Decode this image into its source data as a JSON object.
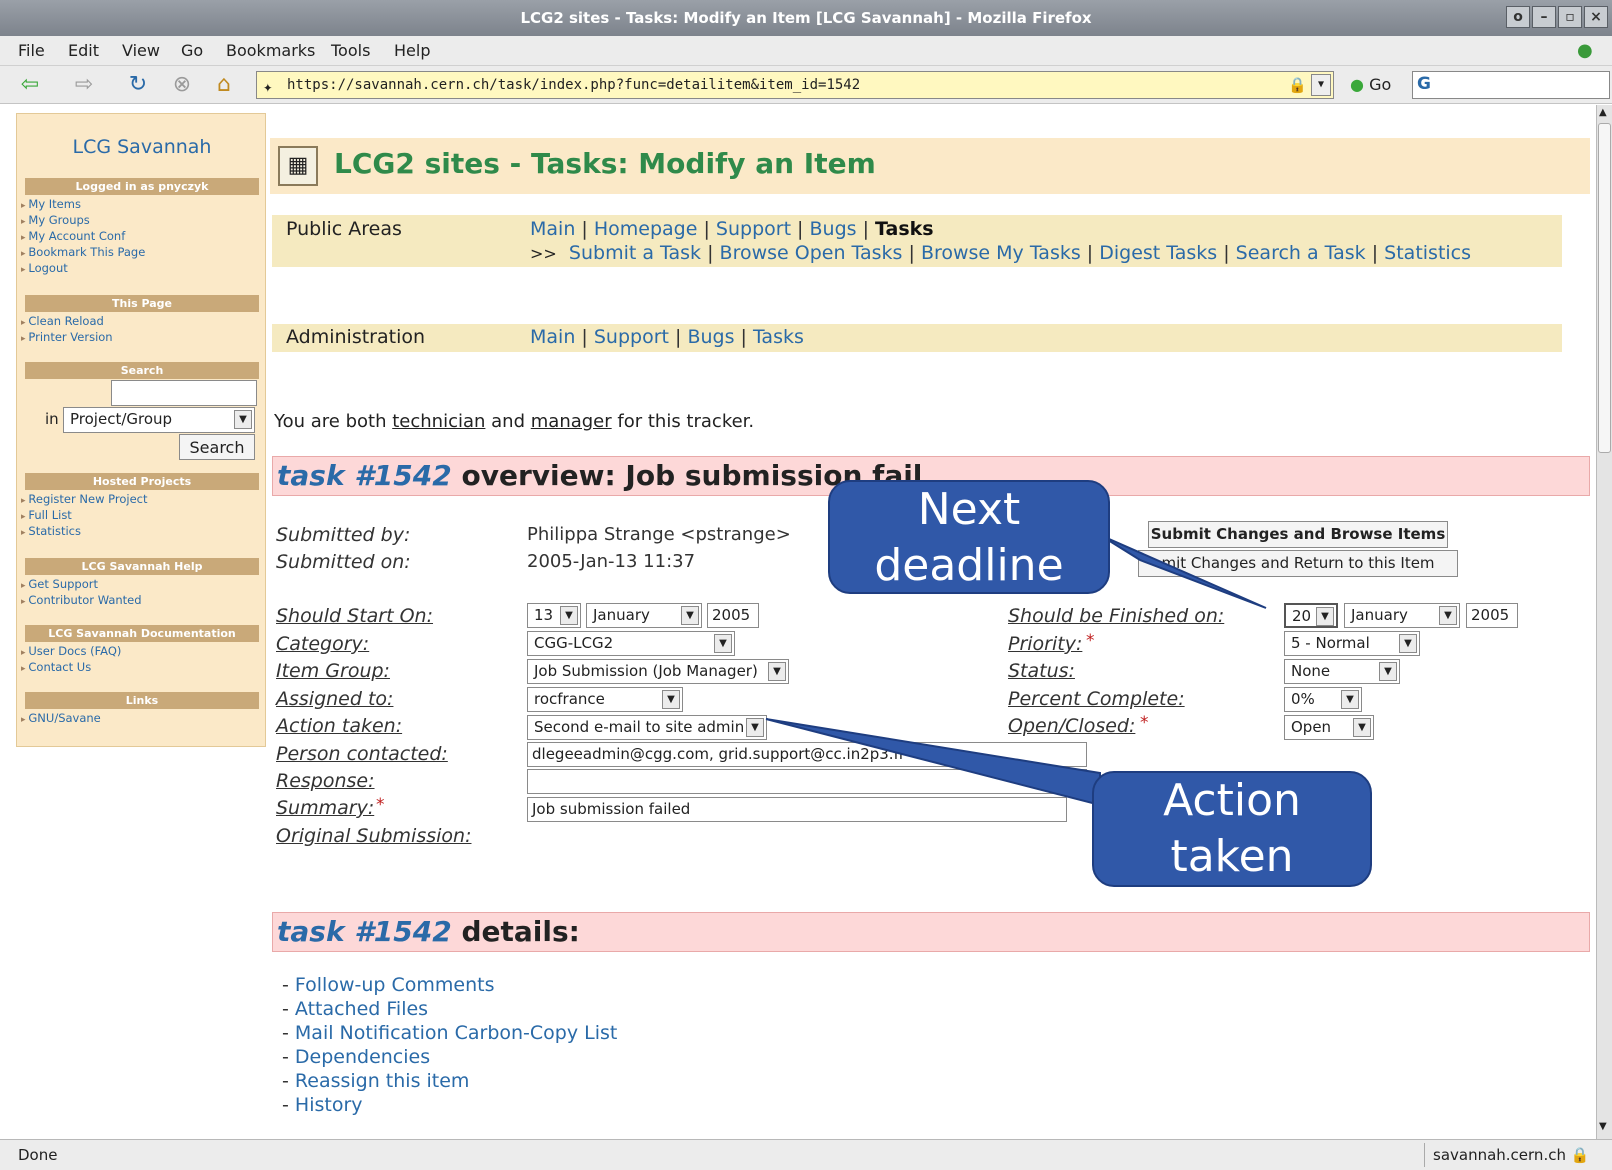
{
  "window": {
    "title": "LCG2 sites - Tasks: Modify an Item [LCG Savannah] - Mozilla Firefox"
  },
  "menu": [
    "File",
    "Edit",
    "View",
    "Go",
    "Bookmarks",
    "Tools",
    "Help"
  ],
  "nav": {
    "url": "https://savannah.cern.ch/task/index.php?func=detailitem&item_id=1542",
    "go_label": "Go"
  },
  "sidebar": {
    "title": "LCG Savannah",
    "logged_in": "Logged in as pnyczyk",
    "user_links": [
      "My Items",
      "My Groups",
      "My Account Conf",
      "Bookmark This Page",
      "Logout"
    ],
    "this_page_head": "This Page",
    "this_page_links": [
      "Clean Reload",
      "Printer Version"
    ],
    "search_head": "Search",
    "search_in_label": "in",
    "search_scope": "Project/Group",
    "search_button": "Search",
    "hosted_head": "Hosted Projects",
    "hosted_links": [
      "Register New Project",
      "Full List",
      "Statistics"
    ],
    "help_head": "LCG Savannah Help",
    "help_links": [
      "Get Support",
      "Contributor Wanted"
    ],
    "docs_head": "LCG Savannah Documentation",
    "docs_links": [
      "User Docs (FAQ)",
      "Contact Us"
    ],
    "links_head": "Links",
    "links_links": [
      "GNU/Savane"
    ]
  },
  "page": {
    "title": "LCG2 sites - Tasks: Modify an Item",
    "public_label": "Public Areas",
    "public_nav": [
      "Main",
      "Homepage",
      "Support",
      "Bugs",
      "Tasks"
    ],
    "public_sub_prefix": ">>",
    "public_sub": [
      "Submit a Task",
      "Browse Open Tasks",
      "Browse My Tasks",
      "Digest Tasks",
      "Search a Task",
      "Statistics"
    ],
    "admin_label": "Administration",
    "admin_nav": [
      "Main",
      "Support",
      "Bugs",
      "Tasks"
    ],
    "role_prefix": "You are both",
    "role_technician": "technician",
    "role_and": "and",
    "role_manager": "manager",
    "role_suffix": "for this tracker."
  },
  "overview": {
    "task_num": "task #1542",
    "heading_rest": "overview: Job submission fail",
    "submitted_by_label": "Submitted by:",
    "submitted_by": "Philippa Strange <pstrange>",
    "submitted_on_label": "Submitted on:",
    "submitted_on": "2005-Jan-13 11:37",
    "btn_browse": "Submit Changes and Browse Items",
    "btn_return": "Submit Changes and Return to this Item",
    "btn_return_visible": "mit Changes and Return to this Item",
    "fields_left": [
      {
        "label": "Should Start On:"
      },
      {
        "label": "Category:",
        "value": "CGG-LCG2"
      },
      {
        "label": "Item Group:",
        "value": "Job Submission (Job Manager)"
      },
      {
        "label": "Assigned to:",
        "value": "rocfrance"
      },
      {
        "label": "Action taken:",
        "value": "Second e-mail to site admin"
      },
      {
        "label": "Person contacted:",
        "value": "dlegeeadmin@cgg.com, grid.support@cc.in2p3.fr"
      },
      {
        "label": "Response:",
        "value": ""
      },
      {
        "label": "Summary:",
        "value": "Job submission failed"
      },
      {
        "label": "Original Submission:"
      }
    ],
    "start_date": {
      "day": "13",
      "month": "January",
      "year": "2005"
    },
    "fields_right": [
      {
        "label": "Should be Finished on:"
      },
      {
        "label": "Priority:",
        "value": "5 - Normal"
      },
      {
        "label": "Status:",
        "value": "None"
      },
      {
        "label": "Percent Complete:",
        "value": "0%"
      },
      {
        "label": "Open/Closed:",
        "value": "Open"
      }
    ],
    "finish_date": {
      "day": "20",
      "month": "January",
      "year": "2005"
    },
    "required_mark": "*"
  },
  "details": {
    "task_num": "task #1542",
    "heading_rest": "details:",
    "links": [
      "Follow-up Comments",
      "Attached Files",
      "Mail Notification Carbon-Copy List",
      "Dependencies",
      "Reassign this item",
      "History"
    ]
  },
  "callouts": {
    "deadline_line1": "Next",
    "deadline_line2": "deadline",
    "action_line1": "Action",
    "action_line2": "taken"
  },
  "status": {
    "left": "Done",
    "right": "savannah.cern.ch"
  },
  "colors": {
    "link": "#2a6aa8",
    "sidebar_bg": "#fbe9c8",
    "section_bg": "#fdd8d8",
    "callout": "#3058a8"
  }
}
